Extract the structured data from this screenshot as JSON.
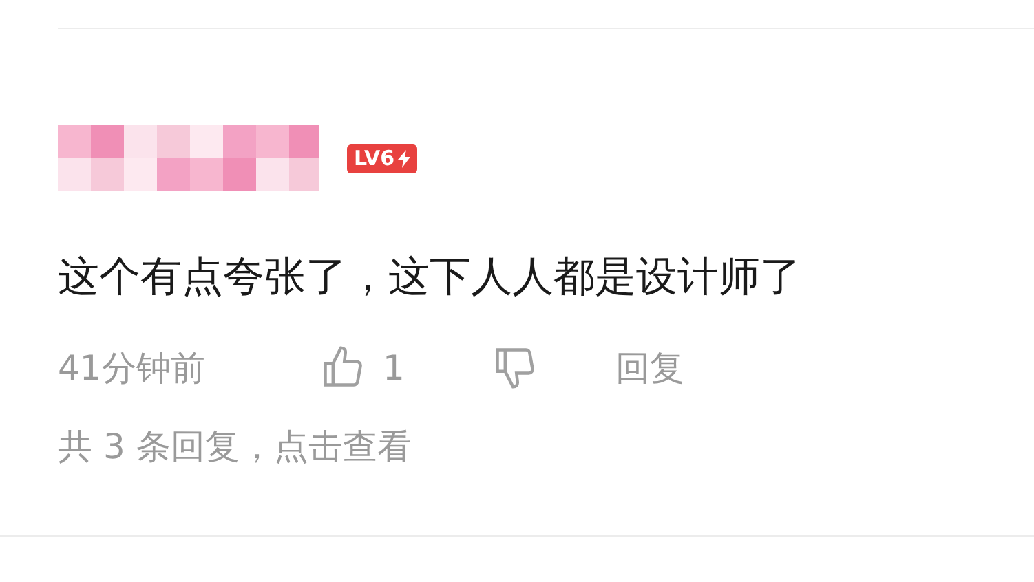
{
  "comment": {
    "level_badge": "LV6",
    "text": "这个有点夸张了，这下人人都是设计师了",
    "time": "41分钟前",
    "likes": "1",
    "reply_button": "回复",
    "replies_link": "共 3 条回复，点击查看"
  }
}
